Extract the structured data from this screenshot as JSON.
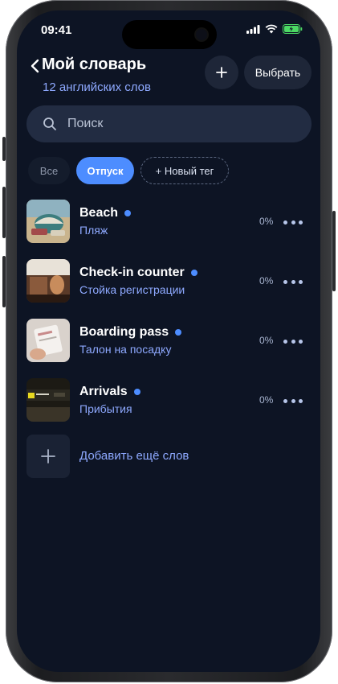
{
  "status_bar": {
    "time": "09:41"
  },
  "header": {
    "title": "Мой словарь",
    "subtitle": "12 английских слов",
    "add_label": "+",
    "select_label": "Выбрать"
  },
  "search": {
    "placeholder": "Поиск"
  },
  "filters": {
    "all": "Все",
    "active": "Отпуск",
    "new_tag": "+ Новый тег"
  },
  "words": [
    {
      "word": "Beach",
      "translation": "Пляж",
      "progress": "0%"
    },
    {
      "word": "Check-in counter",
      "translation": "Стойка регистрации",
      "progress": "0%"
    },
    {
      "word": "Boarding pass",
      "translation": "Талон на посадку",
      "progress": "0%"
    },
    {
      "word": "Arrivals",
      "translation": "Прибытия",
      "progress": "0%"
    }
  ],
  "add_more": {
    "label": "Добавить ещё слов"
  },
  "colors": {
    "accent": "#4d8dff",
    "background": "#0d1424",
    "secondary_text": "#8ea9ff"
  }
}
